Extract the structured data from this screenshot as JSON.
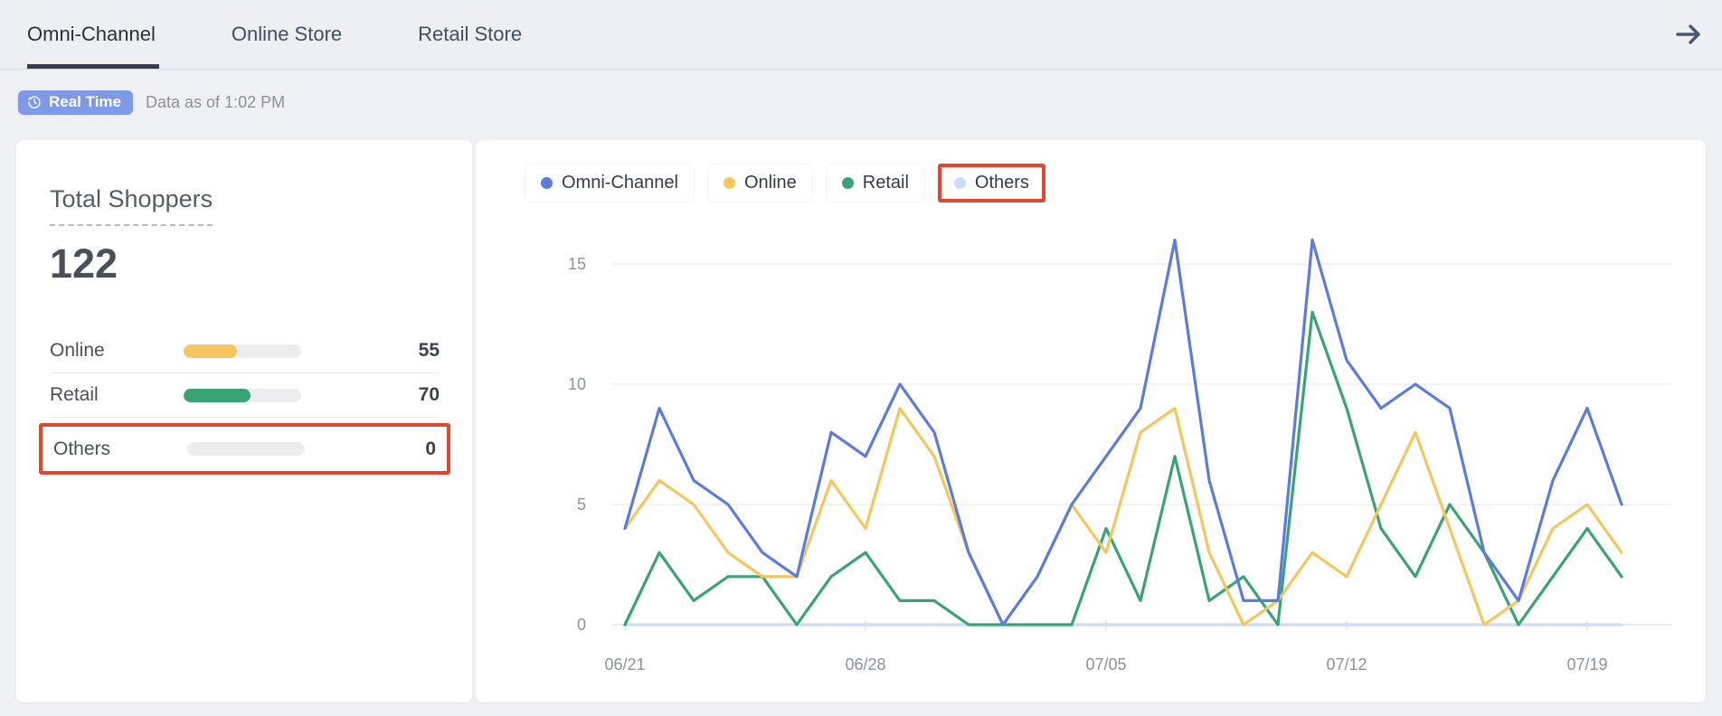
{
  "tabs": {
    "items": [
      {
        "label": "Omni-Channel",
        "active": true
      },
      {
        "label": "Online Store",
        "active": false
      },
      {
        "label": "Retail Store",
        "active": false
      }
    ]
  },
  "status_bar": {
    "badge_label": "Real Time",
    "data_as_of": "Data as of 1:02 PM",
    "badge_color": "#7e99e6"
  },
  "summary_panel": {
    "title": "Total Shoppers",
    "total": "122",
    "rows": [
      {
        "label": "Online",
        "value": "55",
        "color": "#f5c65d",
        "highlighted": false
      },
      {
        "label": "Retail",
        "value": "70",
        "color": "#3aa376",
        "highlighted": false
      },
      {
        "label": "Others",
        "value": "0",
        "color": "#d9dce0",
        "highlighted": true
      }
    ],
    "highlight_color": "#e1472e"
  },
  "chart_data": {
    "type": "line",
    "title": "",
    "xlabel": "",
    "ylabel": "",
    "grid": true,
    "legend_position": "top",
    "ylim": [
      0,
      16.8
    ],
    "yticks": [
      0,
      5,
      10,
      15
    ],
    "x": [
      "06/21",
      "06/22",
      "06/23",
      "06/24",
      "06/25",
      "06/26",
      "06/27",
      "06/28",
      "06/29",
      "06/30",
      "07/01",
      "07/02",
      "07/03",
      "07/04",
      "07/05",
      "07/06",
      "07/07",
      "07/08",
      "07/09",
      "07/10",
      "07/11",
      "07/12",
      "07/13",
      "07/14",
      "07/15",
      "07/16",
      "07/17",
      "07/18",
      "07/19",
      "07/20"
    ],
    "x_tick_labels": [
      "06/21",
      "06/28",
      "07/05",
      "07/12",
      "07/19"
    ],
    "x_tick_indices": [
      0,
      7,
      14,
      21,
      28
    ],
    "series": [
      {
        "name": "Omni-Channel",
        "color": "#5b7cdc",
        "highlighted": false,
        "values": [
          4,
          9,
          6,
          5,
          3,
          2,
          8,
          7,
          10,
          8,
          3,
          0,
          2,
          5,
          7,
          9,
          16,
          6,
          1,
          1,
          16,
          11,
          9,
          10,
          9,
          3,
          1,
          6,
          9,
          5
        ]
      },
      {
        "name": "Online",
        "color": "#f5c65d",
        "highlighted": false,
        "values": [
          4,
          6,
          5,
          3,
          2,
          2,
          6,
          4,
          9,
          7,
          3,
          0,
          2,
          5,
          3,
          8,
          9,
          3,
          0,
          1,
          3,
          2,
          5,
          8,
          4,
          0,
          1,
          4,
          5,
          3
        ]
      },
      {
        "name": "Retail",
        "color": "#3aa376",
        "highlighted": false,
        "values": [
          0,
          3,
          1,
          2,
          2,
          0,
          2,
          3,
          1,
          1,
          0,
          0,
          0,
          0,
          4,
          1,
          7,
          1,
          2,
          0,
          13,
          9,
          4,
          2,
          5,
          3,
          0,
          2,
          4,
          2
        ]
      },
      {
        "name": "Others",
        "color": "#c9ddf8",
        "highlighted": true,
        "values": [
          0,
          0,
          0,
          0,
          0,
          0,
          0,
          0,
          0,
          0,
          0,
          0,
          0,
          0,
          0,
          0,
          0,
          0,
          0,
          0,
          0,
          0,
          0,
          0,
          0,
          0,
          0,
          0,
          0,
          0
        ]
      }
    ]
  }
}
